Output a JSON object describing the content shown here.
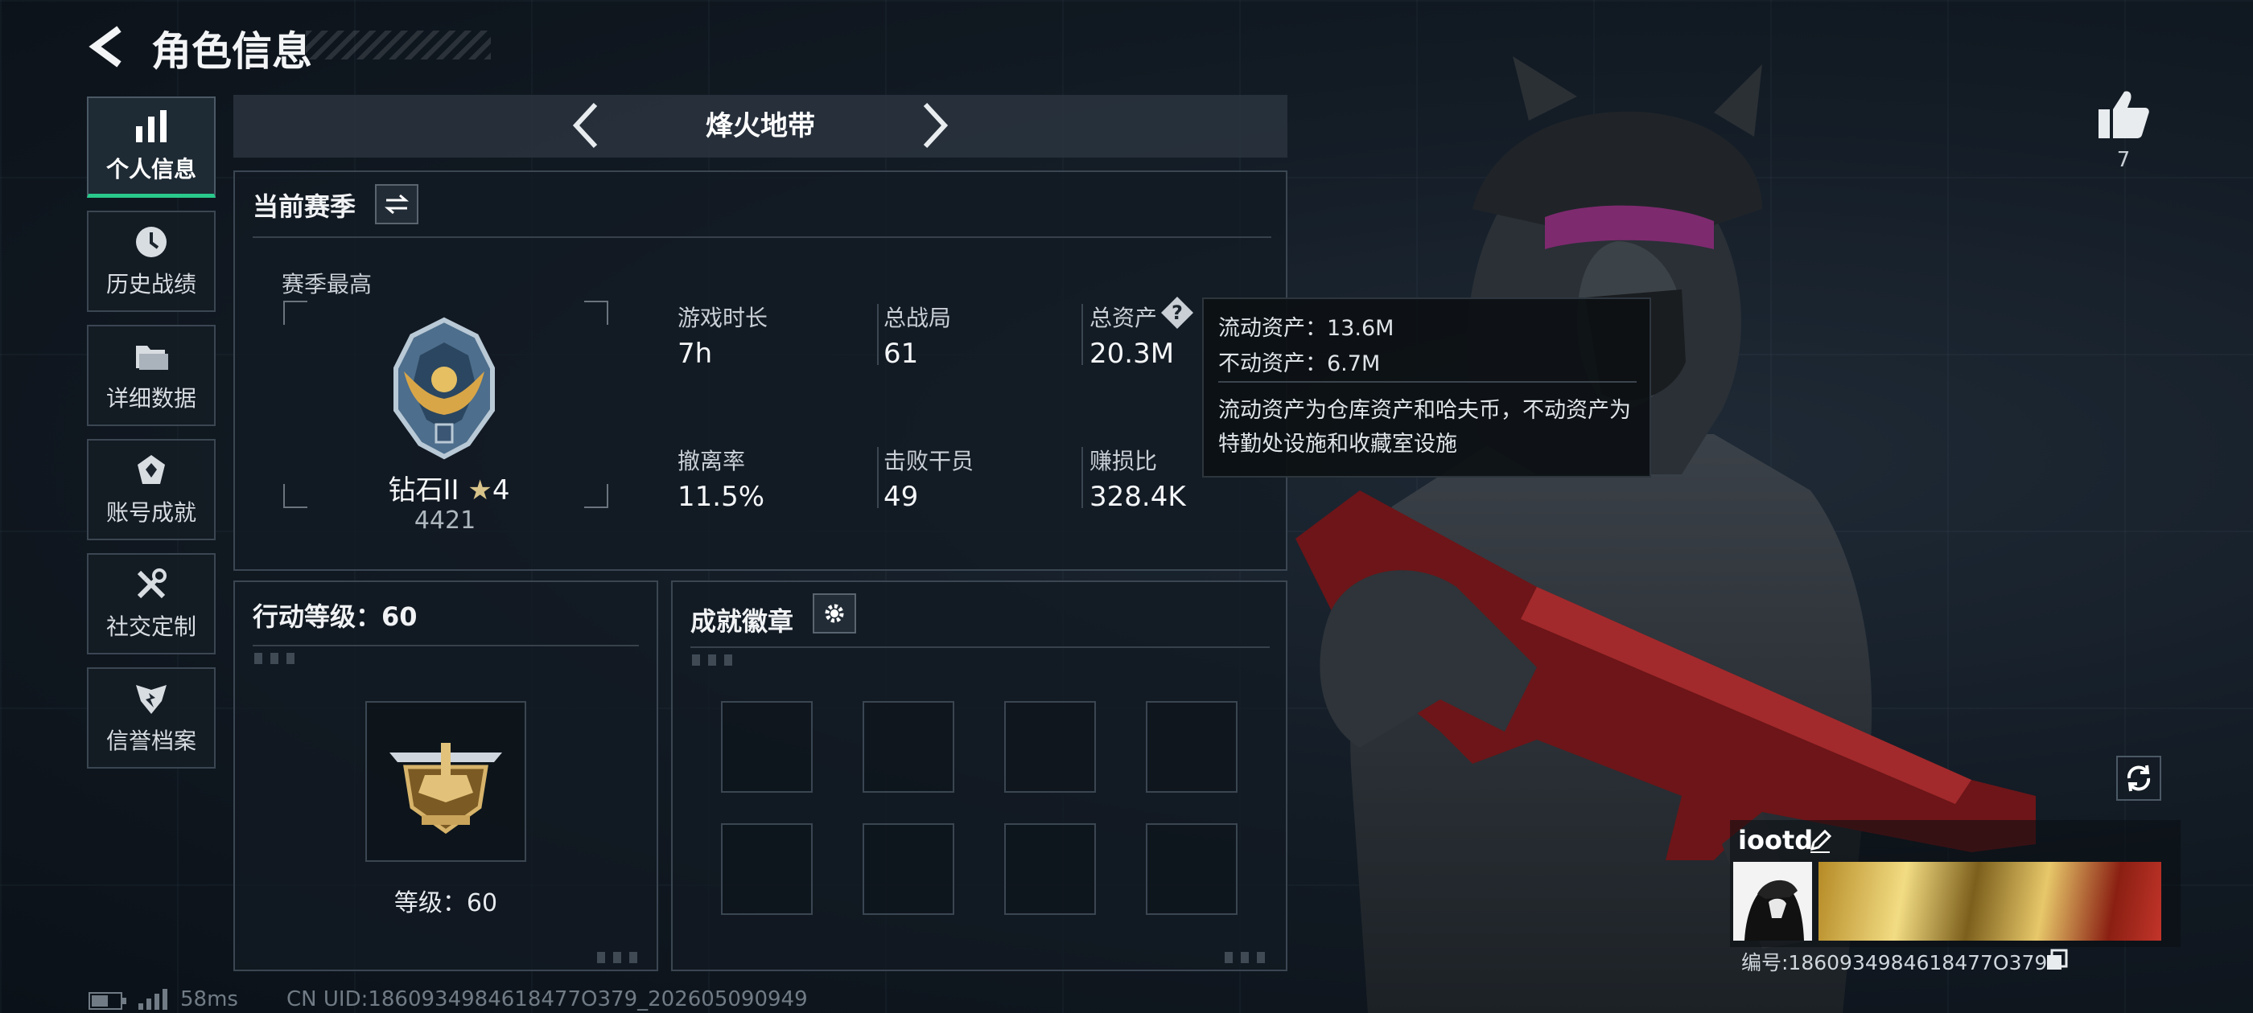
{
  "header": {
    "title": "角色信息"
  },
  "sidebar": {
    "items": [
      {
        "label": "个人信息",
        "icon": "bar-chart-icon",
        "active": true
      },
      {
        "label": "历史战绩",
        "icon": "clock-icon",
        "active": false
      },
      {
        "label": "详细数据",
        "icon": "folder-icon",
        "active": false
      },
      {
        "label": "账号成就",
        "icon": "achievement-icon",
        "active": false
      },
      {
        "label": "社交定制",
        "icon": "tools-icon",
        "active": false
      },
      {
        "label": "信誉档案",
        "icon": "shield-icon",
        "active": false
      }
    ]
  },
  "mode": {
    "title": "烽火地带"
  },
  "season": {
    "title": "当前赛季",
    "best_label": "赛季最高",
    "rank_name": "钻石II",
    "rank_stars": "4",
    "rank_points": "4421",
    "stats": [
      {
        "label": "游戏时长",
        "value": "7h"
      },
      {
        "label": "总战局",
        "value": "61"
      },
      {
        "label": "总资产",
        "value": "20.3M"
      },
      {
        "label": "撤离率",
        "value": "11.5%"
      },
      {
        "label": "击败干员",
        "value": "49"
      },
      {
        "label": "赚损比",
        "value": "328.4K"
      }
    ]
  },
  "tooltip": {
    "liquid": "流动资产：13.6M",
    "fixed": "不动资产：6.7M",
    "description": "流动资产为仓库资产和哈夫币，不动资产为特勤处设施和收藏室设施"
  },
  "action_level": {
    "title": "行动等级：60",
    "level_text": "等级：60"
  },
  "badges": {
    "title": "成就徽章",
    "slots": 8
  },
  "likes": {
    "count": "7"
  },
  "profile": {
    "name": "iootd",
    "id_text": "编号:1860934984618477O379"
  },
  "status_bar": {
    "ping": "58ms",
    "uid": "CN UID:1860934984618477O379_202605090949"
  },
  "colors": {
    "accent": "#29c98b",
    "background": "#111922",
    "panel_border": "#3a4652"
  }
}
